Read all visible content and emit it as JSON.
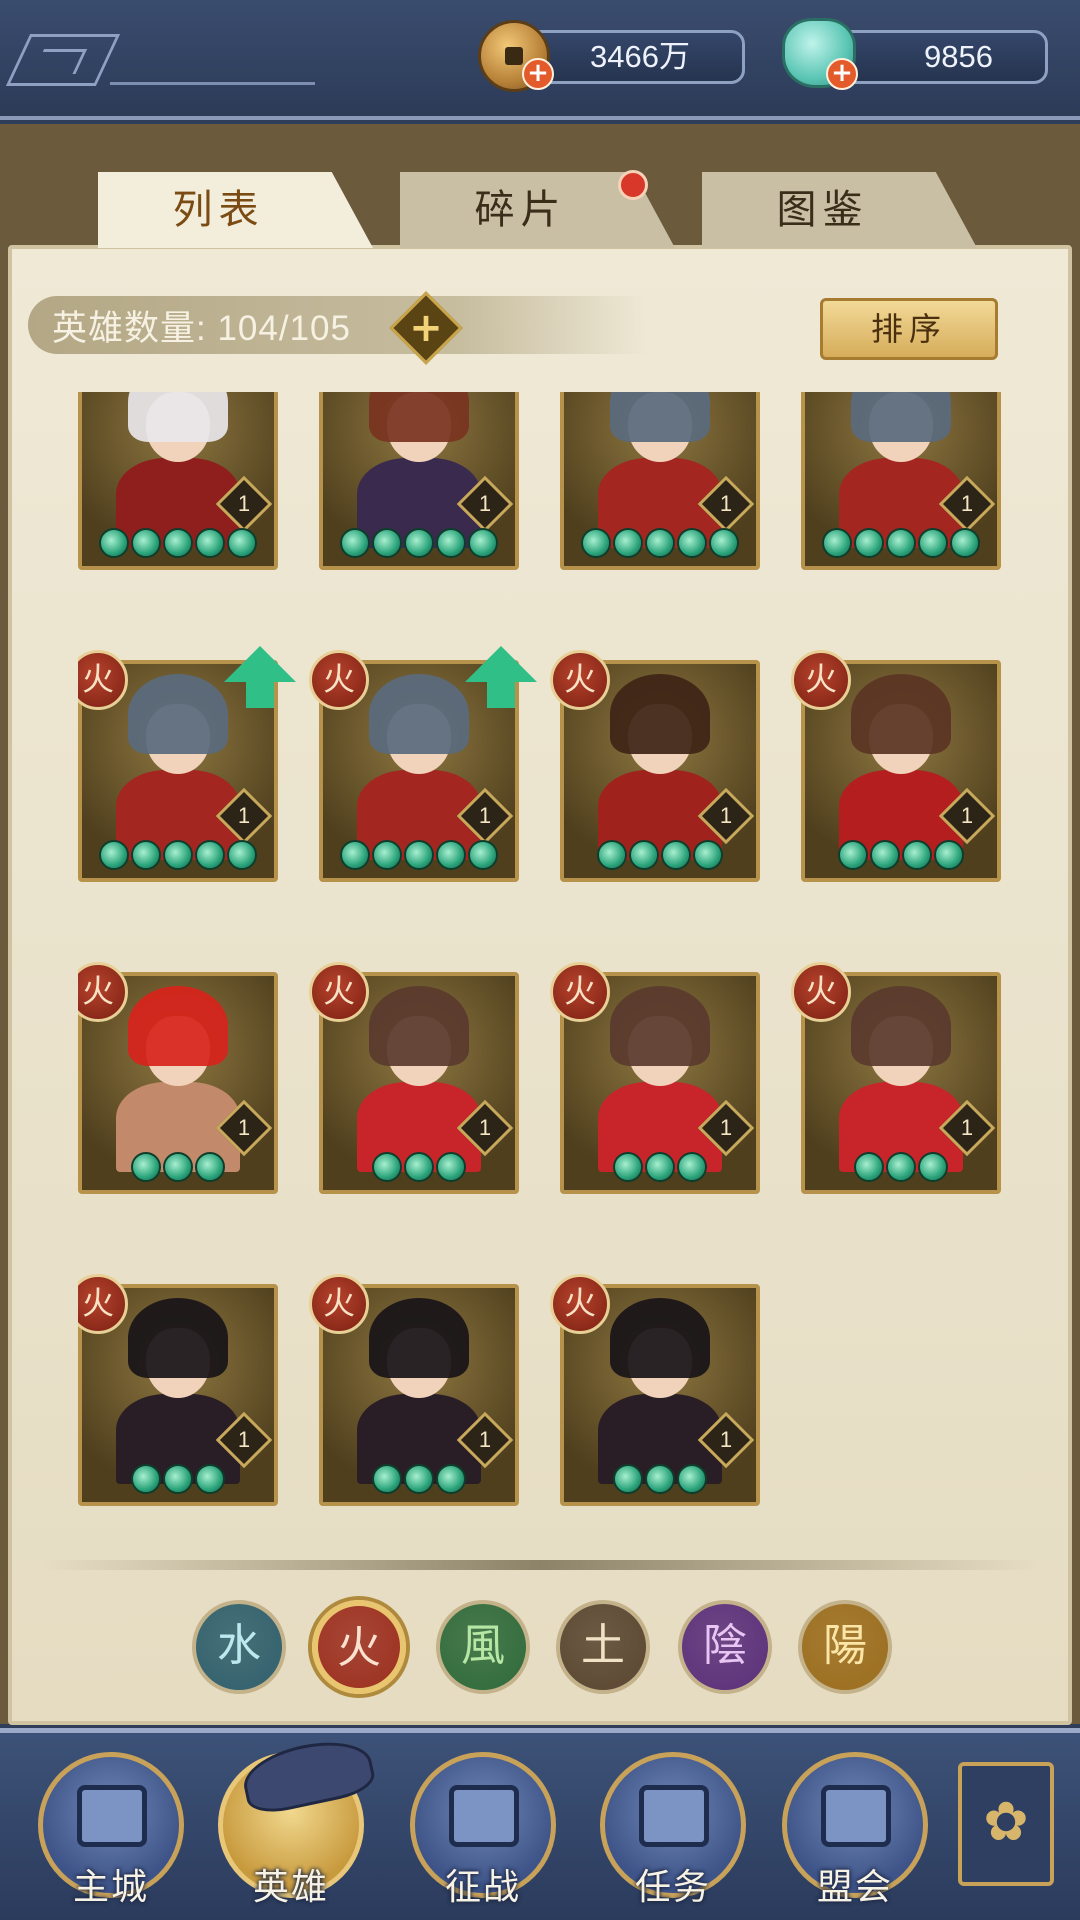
{
  "currencies": {
    "gold": {
      "value": "3466万",
      "icon": "copper-coin-icon"
    },
    "jade": {
      "value": "9856",
      "icon": "jade-shell-icon"
    }
  },
  "tabs": [
    {
      "label": "列表",
      "active": true
    },
    {
      "label": "碎片",
      "active": false,
      "has_notification": true
    },
    {
      "label": "图鉴",
      "active": false
    }
  ],
  "hero_count": {
    "label": "英雄数量: 104/105"
  },
  "sort_button": {
    "label": "排序"
  },
  "element_glyph": "火",
  "heroes": [
    {
      "level": "1",
      "stars": 5,
      "element": "",
      "upgrade": false,
      "hair": "#e9e6ea",
      "outfit": "#8e1f1d"
    },
    {
      "level": "1",
      "stars": 5,
      "element": "",
      "upgrade": false,
      "hair": "#7a3320",
      "outfit": "#3a2a4e"
    },
    {
      "level": "1",
      "stars": 5,
      "element": "",
      "upgrade": false,
      "hair": "#5a6a7e",
      "outfit": "#a42620"
    },
    {
      "level": "1",
      "stars": 5,
      "element": "",
      "upgrade": false,
      "hair": "#5a6a7e",
      "outfit": "#a42620"
    },
    {
      "level": "1",
      "stars": 5,
      "element": "火",
      "upgrade": true,
      "hair": "#5a6a7e",
      "outfit": "#a42620"
    },
    {
      "level": "1",
      "stars": 5,
      "element": "火",
      "upgrade": true,
      "hair": "#5a6a7e",
      "outfit": "#a42620"
    },
    {
      "level": "1",
      "stars": 4,
      "element": "火",
      "upgrade": false,
      "hair": "#3e2416",
      "outfit": "#a0221c"
    },
    {
      "level": "1",
      "stars": 4,
      "element": "火",
      "upgrade": false,
      "hair": "#5a3424",
      "outfit": "#b41e1e"
    },
    {
      "level": "1",
      "stars": 3,
      "element": "火",
      "upgrade": false,
      "hair": "#d8231c",
      "outfit": "#c28a6a"
    },
    {
      "level": "1",
      "stars": 3,
      "element": "火",
      "upgrade": false,
      "hair": "#5a3a2e",
      "outfit": "#c8252a"
    },
    {
      "level": "1",
      "stars": 3,
      "element": "火",
      "upgrade": false,
      "hair": "#5a3a2e",
      "outfit": "#c8252a"
    },
    {
      "level": "1",
      "stars": 3,
      "element": "火",
      "upgrade": false,
      "hair": "#5a3a2e",
      "outfit": "#c8252a"
    },
    {
      "level": "1",
      "stars": 3,
      "element": "火",
      "upgrade": false,
      "hair": "#181418",
      "outfit": "#2a1e26"
    },
    {
      "level": "1",
      "stars": 3,
      "element": "火",
      "upgrade": false,
      "hair": "#181418",
      "outfit": "#2a1e26"
    },
    {
      "level": "1",
      "stars": 3,
      "element": "火",
      "upgrade": false,
      "hair": "#181418",
      "outfit": "#2a1e26"
    }
  ],
  "element_filters": [
    {
      "glyph": "水",
      "name": "water",
      "bg": "#2f5f6c",
      "fg": "#bde9ee",
      "selected": false
    },
    {
      "glyph": "火",
      "name": "fire",
      "bg": "#9c2f1f",
      "fg": "#fbe1cf",
      "selected": true
    },
    {
      "glyph": "風",
      "name": "wind",
      "bg": "#2f6a3a",
      "fg": "#b7e7a5",
      "selected": false
    },
    {
      "glyph": "土",
      "name": "earth",
      "bg": "#5a4630",
      "fg": "#f0e2c4",
      "selected": false
    },
    {
      "glyph": "陰",
      "name": "yin",
      "bg": "#5b2f7a",
      "fg": "#e7c6f4",
      "selected": false
    },
    {
      "glyph": "陽",
      "name": "yang",
      "bg": "#9b6d1d",
      "fg": "#fbe6a8",
      "selected": false
    }
  ],
  "nav": [
    {
      "label": "主城",
      "name": "city",
      "active": false
    },
    {
      "label": "英雄",
      "name": "heroes",
      "active": true
    },
    {
      "label": "征战",
      "name": "campaign",
      "active": false
    },
    {
      "label": "任务",
      "name": "quests",
      "active": false
    },
    {
      "label": "盟会",
      "name": "guild",
      "active": false
    }
  ],
  "more_icon": "menu-grid-icon"
}
